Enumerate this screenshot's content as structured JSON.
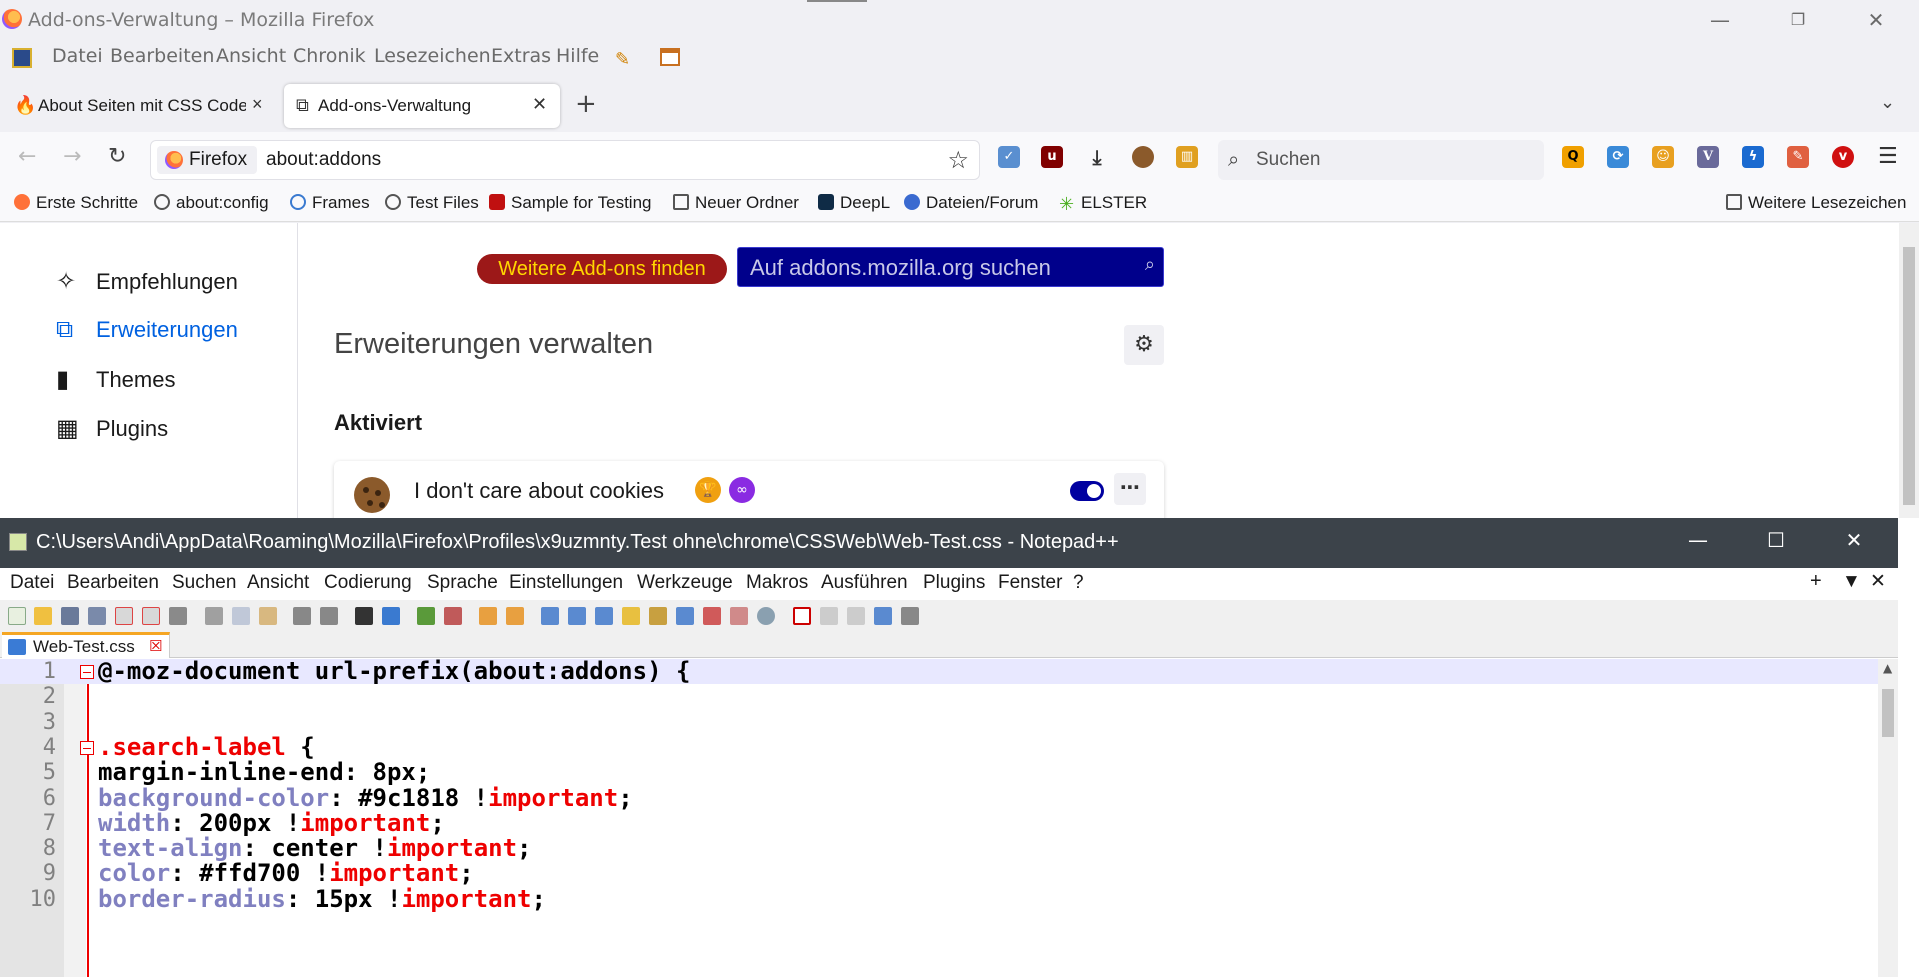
{
  "firefox": {
    "window_title": "Add-ons-Verwaltung – Mozilla Firefox",
    "menu": [
      "Datei",
      "Bearbeiten",
      "Ansicht",
      "Chronik",
      "Lesezeichen",
      "Extras",
      "Hilfe"
    ],
    "tabs": [
      {
        "label": "About Seiten mit CSS Code",
        "active": false
      },
      {
        "label": "Add-ons-Verwaltung",
        "active": true
      }
    ],
    "urlbar": {
      "identity": "Firefox",
      "url": "about:addons"
    },
    "search_placeholder": "Suchen",
    "bookmarks": [
      "Erste Schritte",
      "about:config",
      "Frames",
      "Test Files",
      "Sample for Testing",
      "Neuer Ordner",
      "DeepL",
      "Dateien/Forum",
      "ELSTER"
    ],
    "bookmarks_more": "Weitere Lesezeichen",
    "addons": {
      "find_button": "Weitere Add-ons finden",
      "amo_search_placeholder": "Auf addons.mozilla.org suchen",
      "categories": [
        "Empfehlungen",
        "Erweiterungen",
        "Themes",
        "Plugins"
      ],
      "selected_category": "Erweiterungen",
      "heading": "Erweiterungen verwalten",
      "section_enabled": "Aktiviert",
      "addon": {
        "name": "I don't care about cookies",
        "enabled": true
      }
    },
    "colors": {
      "find_button_bg": "#9c1818",
      "find_button_text": "#ffd700",
      "amo_search_bg": "#00008b",
      "selected_category": "#0061e0"
    }
  },
  "notepadpp": {
    "window_title": "C:\\Users\\Andi\\AppData\\Roaming\\Mozilla\\Firefox\\Profiles\\x9uzmnty.Test ohne\\chrome\\CSSWeb\\Web-Test.css - Notepad++",
    "menu": [
      "Datei",
      "Bearbeiten",
      "Suchen",
      "Ansicht",
      "Codierung",
      "Sprache",
      "Einstellungen",
      "Werkzeuge",
      "Makros",
      "Ausführen",
      "Plugins",
      "Fenster",
      "?"
    ],
    "tab": "Web-Test.css",
    "lines": [
      {
        "n": "1",
        "parts": [
          {
            "t": "@-moz-document url-prefix(about:addons) {",
            "c": "plain"
          }
        ]
      },
      {
        "n": "2",
        "parts": []
      },
      {
        "n": "3",
        "parts": []
      },
      {
        "n": "4",
        "parts": [
          {
            "t": ".search-label",
            "c": "sel-name"
          },
          {
            "t": " {",
            "c": "plain"
          }
        ]
      },
      {
        "n": "5",
        "parts": [
          {
            "t": "margin-inline-end: 8px;",
            "c": "plain"
          }
        ]
      },
      {
        "n": "6",
        "parts": [
          {
            "t": "background-color",
            "c": "prop"
          },
          {
            "t": ": #9c1818 !",
            "c": "plain"
          },
          {
            "t": "important",
            "c": "imp"
          },
          {
            "t": ";",
            "c": "plain"
          }
        ]
      },
      {
        "n": "7",
        "parts": [
          {
            "t": "width",
            "c": "prop"
          },
          {
            "t": ": 200px !",
            "c": "plain"
          },
          {
            "t": "important",
            "c": "imp"
          },
          {
            "t": ";",
            "c": "plain"
          }
        ]
      },
      {
        "n": "8",
        "parts": [
          {
            "t": "text-align",
            "c": "prop"
          },
          {
            "t": ": center !",
            "c": "plain"
          },
          {
            "t": "important",
            "c": "imp"
          },
          {
            "t": ";",
            "c": "plain"
          }
        ]
      },
      {
        "n": "9",
        "parts": [
          {
            "t": "color",
            "c": "prop"
          },
          {
            "t": ": #ffd700 !",
            "c": "plain"
          },
          {
            "t": "important",
            "c": "imp"
          },
          {
            "t": ";",
            "c": "plain"
          }
        ]
      },
      {
        "n": "10",
        "parts": [
          {
            "t": "border-radius",
            "c": "prop"
          },
          {
            "t": ": 15px !",
            "c": "plain"
          },
          {
            "t": "important",
            "c": "imp"
          },
          {
            "t": ";",
            "c": "plain"
          }
        ]
      }
    ],
    "colors": {
      "keyword_red": "#ee0000",
      "property": "#8080c0",
      "tab_accent": "#f5a623"
    }
  }
}
